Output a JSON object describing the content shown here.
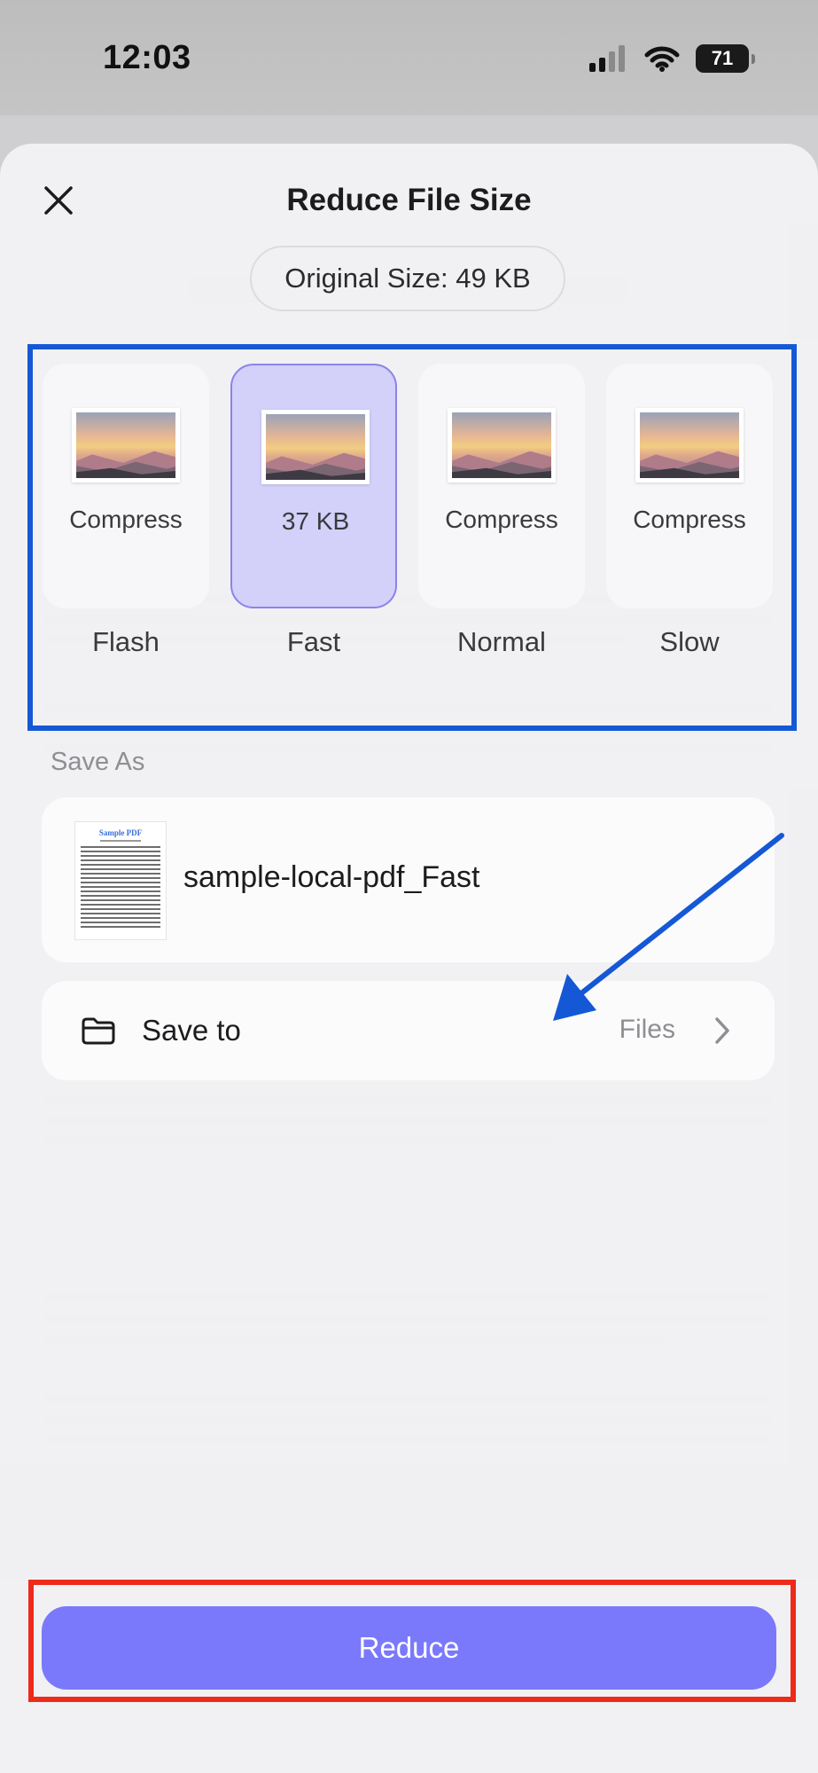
{
  "status_bar": {
    "time": "12:03",
    "battery": "71"
  },
  "sheet": {
    "title": "Reduce File Size",
    "original_size": "Original Size: 49 KB"
  },
  "options": [
    {
      "value": "Compress",
      "label": "Flash",
      "selected": false
    },
    {
      "value": "37 KB",
      "label": "Fast",
      "selected": true
    },
    {
      "value": "Compress",
      "label": "Normal",
      "selected": false
    },
    {
      "value": "Compress",
      "label": "Slow",
      "selected": false
    }
  ],
  "save_as": {
    "label": "Save As",
    "file_name": "sample-local-pdf_Fast",
    "thumb_title": "Sample PDF"
  },
  "save_to": {
    "label": "Save to",
    "value": "Files"
  },
  "action": {
    "reduce_label": "Reduce"
  },
  "colors": {
    "accent": "#7b79fb",
    "selected_card": "#d3d0fa",
    "annotation_blue": "#1558d6",
    "annotation_red": "#ee2a1a"
  }
}
